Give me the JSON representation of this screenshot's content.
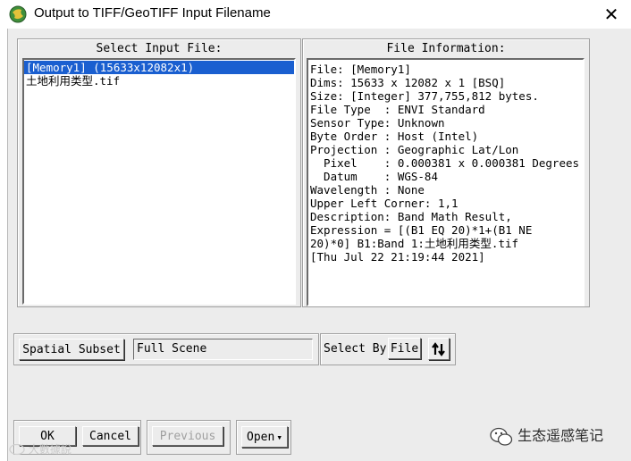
{
  "window": {
    "title": "Output to TIFF/GeoTIFF Input Filename",
    "close_glyph": "✕",
    "icon": "envi-globe-icon"
  },
  "input_panel": {
    "label": "Select Input File:",
    "files": [
      {
        "label": "[Memory1] (15633x12082x1)",
        "selected": true
      },
      {
        "label": "土地利用类型.tif",
        "selected": false
      }
    ]
  },
  "info_panel": {
    "label": "File Information:",
    "lines": [
      "File: [Memory1]",
      "Dims: 15633 x 12082 x 1 [BSQ]",
      "Size: [Integer] 377,755,812 bytes.",
      "File Type  : ENVI Standard",
      "Sensor Type: Unknown",
      "Byte Order : Host (Intel)",
      "Projection : Geographic Lat/Lon",
      "  Pixel    : 0.000381 x 0.000381 Degrees",
      "  Datum    : WGS-84",
      "Wavelength : None",
      "Upper Left Corner: 1,1",
      "Description: Band Math Result,",
      "Expression = [(B1 EQ 20)*1+(B1 NE",
      "20)*0] B1:Band 1:土地利用类型.tif",
      "[Thu Jul 22 21:19:44 2021]"
    ]
  },
  "subset": {
    "button_label": "Spatial Subset",
    "value": "Full Scene"
  },
  "select_by": {
    "label": "Select By",
    "value": "File",
    "sort_glyph": "⇅"
  },
  "footer": {
    "ok_label": "OK",
    "cancel_label": "Cancel",
    "previous_label": "Previous",
    "open_label": "Open",
    "open_arrow": "▾"
  },
  "watermarks": {
    "left_text": "大數據說",
    "right_text": "生态遥感笔记"
  },
  "colors": {
    "selection": "#1a5fd0",
    "dialog_bg": "#ececec"
  }
}
